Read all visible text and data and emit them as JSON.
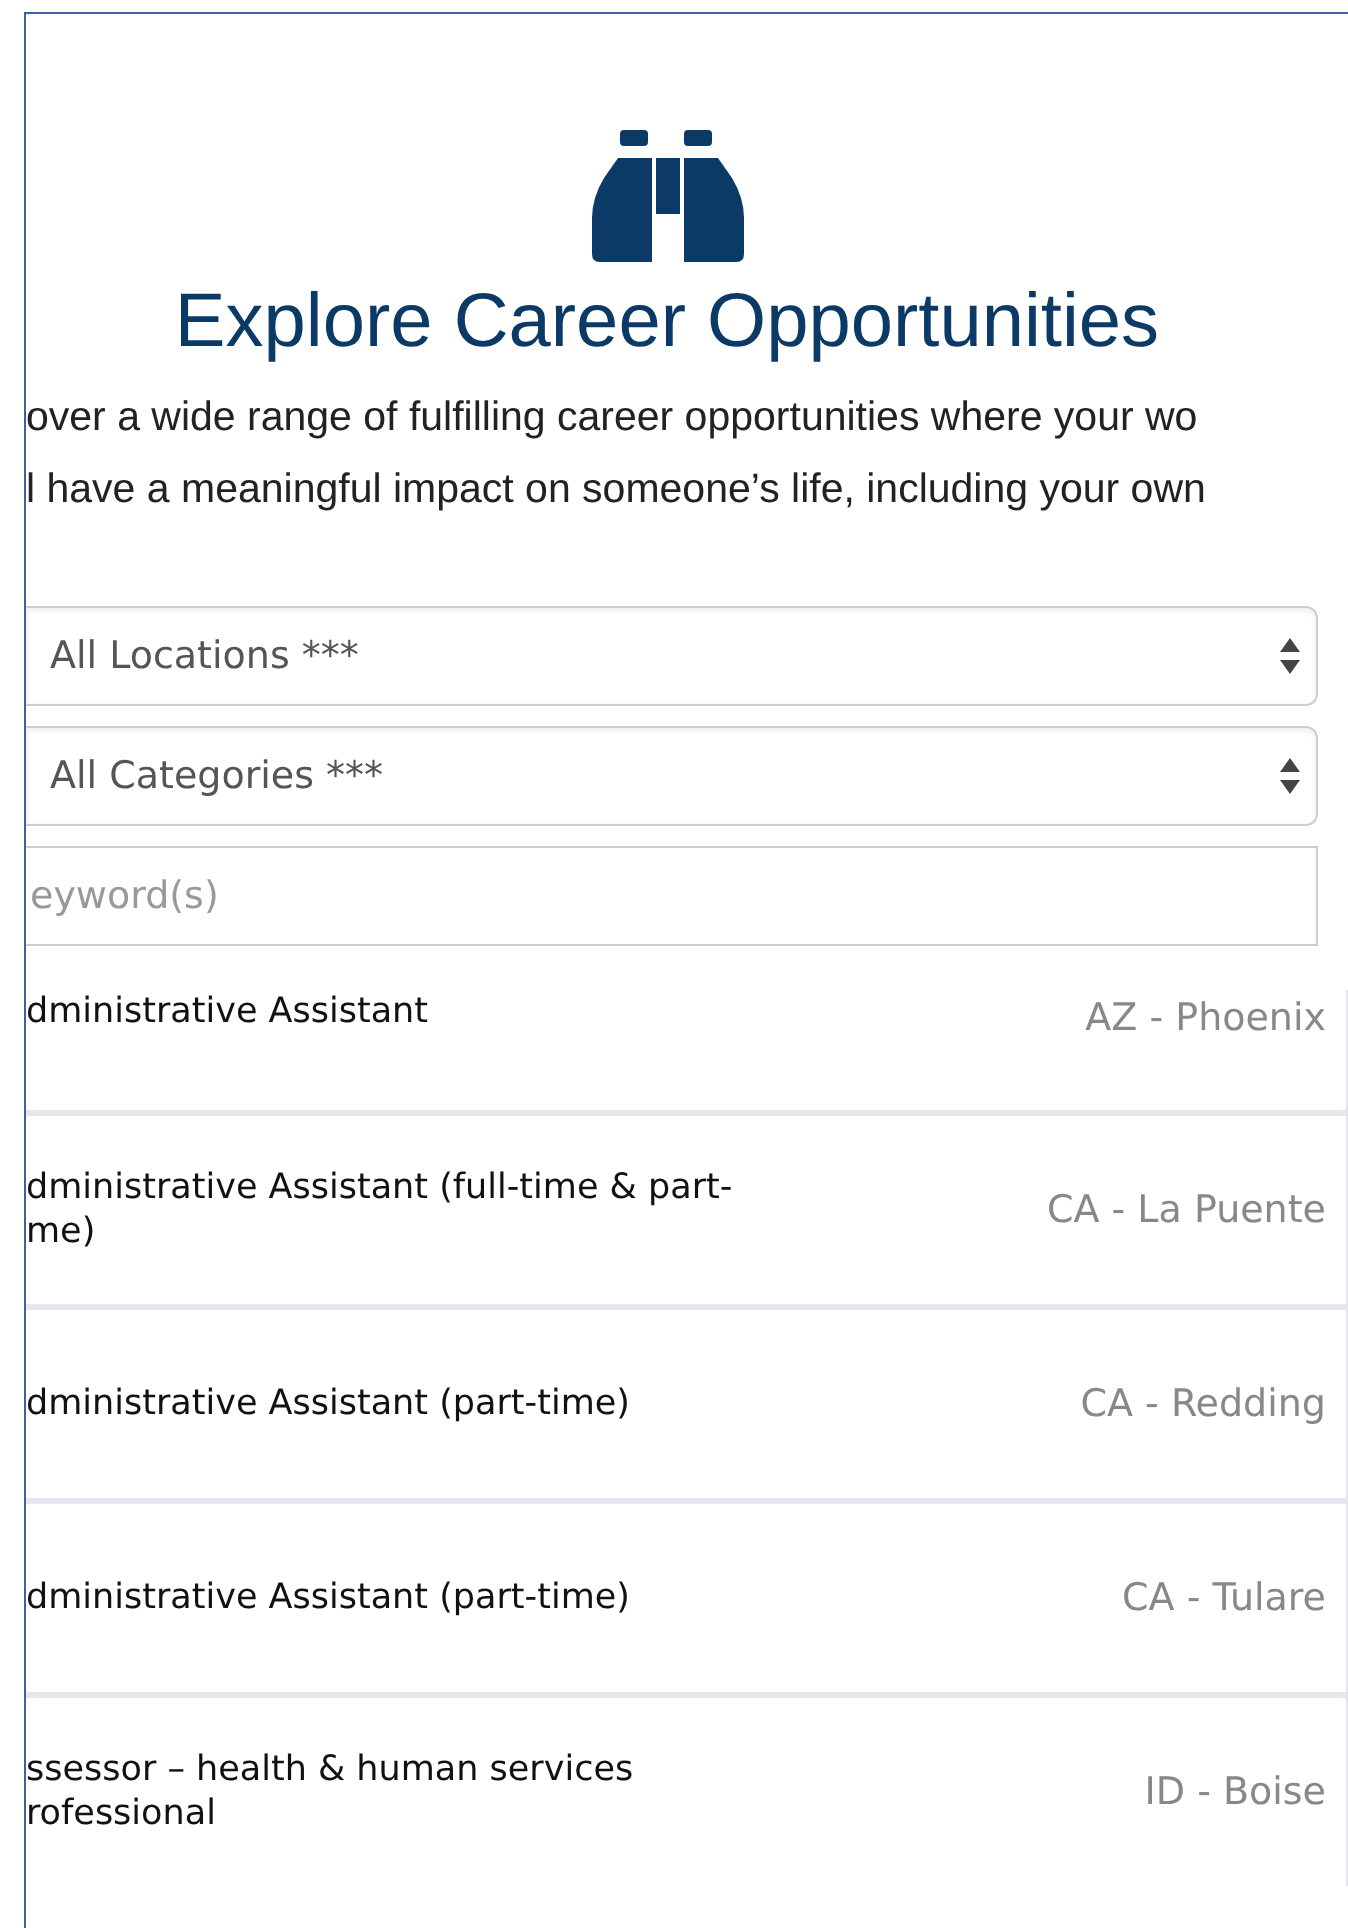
{
  "heading": "Explore Career Opportunities",
  "intro_lines": [
    "over a wide range of fulfilling career opportunities where your wo",
    "l have a meaningful impact on someone’s life, including your own"
  ],
  "filters": [
    {
      "kind": "select",
      "value": "All Locations ***"
    },
    {
      "kind": "select",
      "value": "All Categories ***"
    },
    {
      "kind": "text",
      "placeholder": "eyword(s)"
    }
  ],
  "jobs": [
    {
      "title_lines": [
        "dministrative Assistant"
      ],
      "location": "AZ - Phoenix"
    },
    {
      "title_lines": [
        "dministrative Assistant (full-time & part-",
        "me)"
      ],
      "location": "CA - La Puente"
    },
    {
      "title_lines": [
        "dministrative Assistant (part-time)"
      ],
      "location": "CA - Redding"
    },
    {
      "title_lines": [
        "dministrative Assistant (part-time)"
      ],
      "location": "CA - Tulare"
    },
    {
      "title_lines": [
        "ssessor – health & human services",
        "rofessional"
      ],
      "location": "ID - Boise"
    }
  ]
}
